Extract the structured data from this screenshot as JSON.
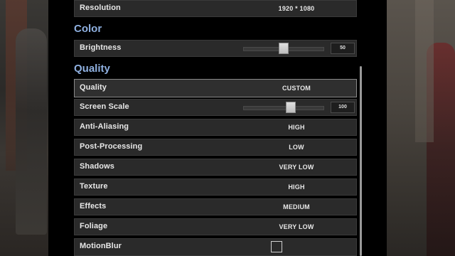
{
  "sections": {
    "color": "Color",
    "quality": "Quality"
  },
  "rows": {
    "resolution": {
      "label": "Resolution",
      "value": "1920 * 1080"
    },
    "brightness": {
      "label": "Brightness",
      "value": "50",
      "level": 0.5
    },
    "quality": {
      "label": "Quality",
      "value": "CUSTOM"
    },
    "screen_scale": {
      "label": "Screen Scale",
      "value": "100",
      "level": 0.6
    },
    "anti_aliasing": {
      "label": "Anti-Aliasing",
      "value": "HIGH"
    },
    "post_processing": {
      "label": "Post-Processing",
      "value": "LOW"
    },
    "shadows": {
      "label": "Shadows",
      "value": "VERY LOW"
    },
    "texture": {
      "label": "Texture",
      "value": "HIGH"
    },
    "effects": {
      "label": "Effects",
      "value": "MEDIUM"
    },
    "foliage": {
      "label": "Foliage",
      "value": "VERY LOW"
    },
    "motion_blur": {
      "label": "MotionBlur",
      "checked": false
    }
  },
  "colors": {
    "section_heading": "#8fb0e0",
    "panel_bg": "#000000",
    "row_bg": "#2a2a2a"
  }
}
